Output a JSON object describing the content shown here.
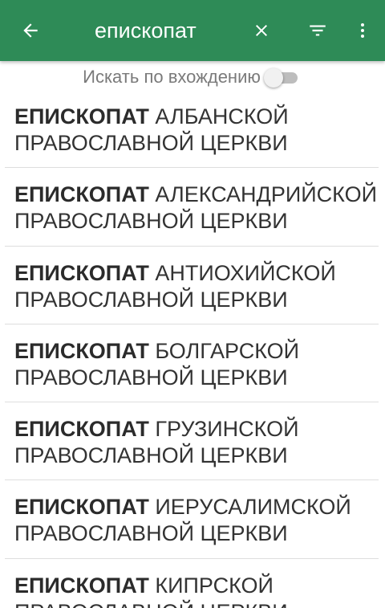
{
  "topbar": {
    "back_icon": "arrow-back-icon",
    "search_query": "епископат",
    "clear_icon": "close-icon",
    "filter_icon": "filter-icon",
    "more_icon": "more-vert-icon",
    "background_color": "#2e8b57"
  },
  "toggle": {
    "label": "Искать по вхождению",
    "checked": false
  },
  "results": [
    {
      "highlight": "ЕПИСКОПАТ",
      "rest": "АЛБАНСКОЙ",
      "line2": "ПРАВОСЛАВНОЙ ЦЕРКВИ"
    },
    {
      "highlight": "ЕПИСКОПАТ",
      "rest": "АЛЕКСАНДРИЙСКОЙ",
      "line2": "ПРАВОСЛАВНОЙ ЦЕРКВИ"
    },
    {
      "highlight": "ЕПИСКОПАТ",
      "rest": "АНТИОХИЙСКОЙ",
      "line2": "ПРАВОСЛАВНОЙ ЦЕРКВИ"
    },
    {
      "highlight": "ЕПИСКОПАТ",
      "rest": "БОЛГАРСКОЙ",
      "line2": "ПРАВОСЛАВНОЙ ЦЕРКВИ"
    },
    {
      "highlight": "ЕПИСКОПАТ",
      "rest": "ГРУЗИНСКОЙ",
      "line2": "ПРАВОСЛАВНОЙ ЦЕРКВИ"
    },
    {
      "highlight": "ЕПИСКОПАТ",
      "rest": "ИЕРУСАЛИМСКОЙ",
      "line2": "ПРАВОСЛАВНОЙ ЦЕРКВИ"
    },
    {
      "highlight": "ЕПИСКОПАТ",
      "rest": "КИПРСКОЙ",
      "line2": "ПРАВОСЛАВНОЙ ЦЕРКВИ"
    }
  ]
}
